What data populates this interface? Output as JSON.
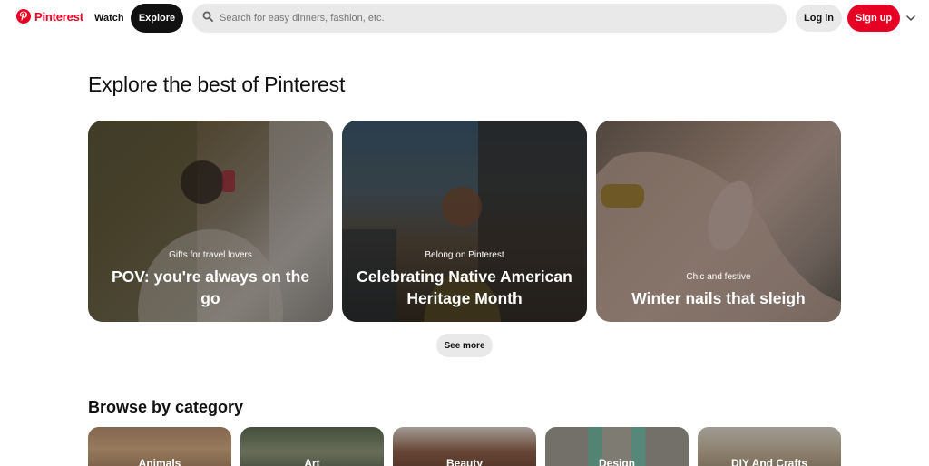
{
  "header": {
    "logo_text": "Pinterest",
    "nav_watch": "Watch",
    "nav_explore": "Explore",
    "search_placeholder": "Search for easy dinners, fashion, etc.",
    "login_label": "Log in",
    "signup_label": "Sign up"
  },
  "colors": {
    "brand": "#e60023",
    "chip_bg": "#e9e9e9",
    "active_tab_bg": "#111111"
  },
  "main": {
    "title": "Explore the best of Pinterest",
    "cards": [
      {
        "subtitle": "Gifts for travel lovers",
        "headline": "POV: you're always on the go"
      },
      {
        "subtitle": "Belong on Pinterest",
        "headline": "Celebrating Native American Heritage Month"
      },
      {
        "subtitle": "Chic and festive",
        "headline": "Winter nails that sleigh"
      }
    ],
    "see_more": "See more"
  },
  "categories": {
    "title": "Browse by category",
    "items": [
      {
        "label": "Animals"
      },
      {
        "label": "Art"
      },
      {
        "label": "Beauty"
      },
      {
        "label": "Design"
      },
      {
        "label": "DIY And Crafts"
      }
    ]
  }
}
